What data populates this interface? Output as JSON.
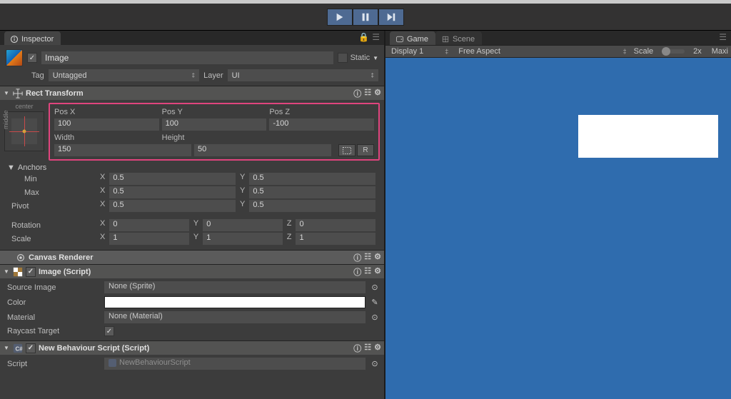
{
  "tabs": {
    "inspector": "Inspector",
    "game": "Game",
    "scene": "Scene"
  },
  "object": {
    "name": "Image",
    "static_label": "Static"
  },
  "taglayer": {
    "tag_label": "Tag",
    "tag_value": "Untagged",
    "layer_label": "Layer",
    "layer_value": "UI"
  },
  "rect": {
    "title": "Rect Transform",
    "anchor_top": "center",
    "anchor_side": "middle",
    "pos_x_label": "Pos X",
    "pos_y_label": "Pos Y",
    "pos_z_label": "Pos Z",
    "pos_x": "100",
    "pos_y": "100",
    "pos_z": "-100",
    "width_label": "Width",
    "height_label": "Height",
    "width": "150",
    "height": "50",
    "blueprint": "⊡",
    "raw": "R",
    "anchors_label": "Anchors",
    "min_label": "Min",
    "max_label": "Max",
    "min_x": "0.5",
    "min_y": "0.5",
    "max_x": "0.5",
    "max_y": "0.5",
    "pivot_label": "Pivot",
    "pivot_x": "0.5",
    "pivot_y": "0.5",
    "rotation_label": "Rotation",
    "rot_x": "0",
    "rot_y": "0",
    "rot_z": "0",
    "scale_label": "Scale",
    "scale_x": "1",
    "scale_y": "1",
    "scale_z": "1"
  },
  "canvas": {
    "title": "Canvas Renderer"
  },
  "image": {
    "title": "Image (Script)",
    "srcimg_label": "Source Image",
    "srcimg_value": "None (Sprite)",
    "color_label": "Color",
    "color_value": "#ffffff",
    "material_label": "Material",
    "material_value": "None (Material)",
    "raycast_label": "Raycast Target"
  },
  "script": {
    "title": "New Behaviour Script (Script)",
    "script_label": "Script",
    "script_value": "NewBehaviourScript"
  },
  "gameview": {
    "display": "Display 1",
    "aspect": "Free Aspect",
    "scale_label": "Scale",
    "zoom": "2x",
    "maxi": "Maxi"
  }
}
